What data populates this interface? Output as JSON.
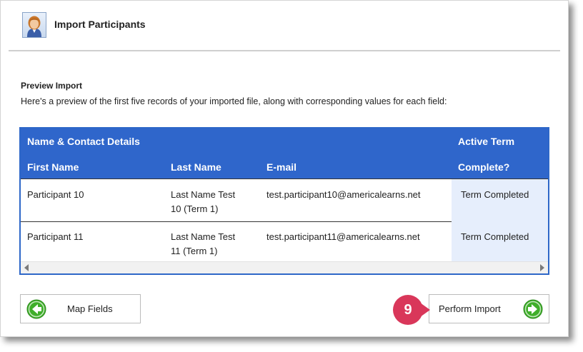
{
  "header": {
    "title": "Import Participants",
    "icon": "person-avatar-icon"
  },
  "preview": {
    "title": "Preview Import",
    "description": "Here's a preview of the first five records of your imported file, along with corresponding values for each field:"
  },
  "table": {
    "group_headers": {
      "contact": "Name & Contact Details",
      "term": "Active Term"
    },
    "columns": [
      "First Name",
      "Last Name",
      "E-mail",
      "Complete?"
    ],
    "rows": [
      {
        "first_name": "Participant 10",
        "last_name_line1": "Last Name Test",
        "last_name_line2": "10 (Term 1)",
        "email": "test.participant10@americalearns.net",
        "term": "Term Completed"
      },
      {
        "first_name": "Participant 11",
        "last_name_line1": "Last Name Test",
        "last_name_line2": "11 (Term 1)",
        "email": "test.participant11@americalearns.net",
        "term": "Term Completed"
      }
    ]
  },
  "buttons": {
    "map_fields": "Map Fields",
    "perform_import": "Perform Import"
  },
  "badge": {
    "number": "9"
  },
  "colors": {
    "header_blue": "#2f66cb",
    "term_cell": "#e6eefc",
    "badge": "#d9375a",
    "arrow_green": "#3fae2a"
  }
}
